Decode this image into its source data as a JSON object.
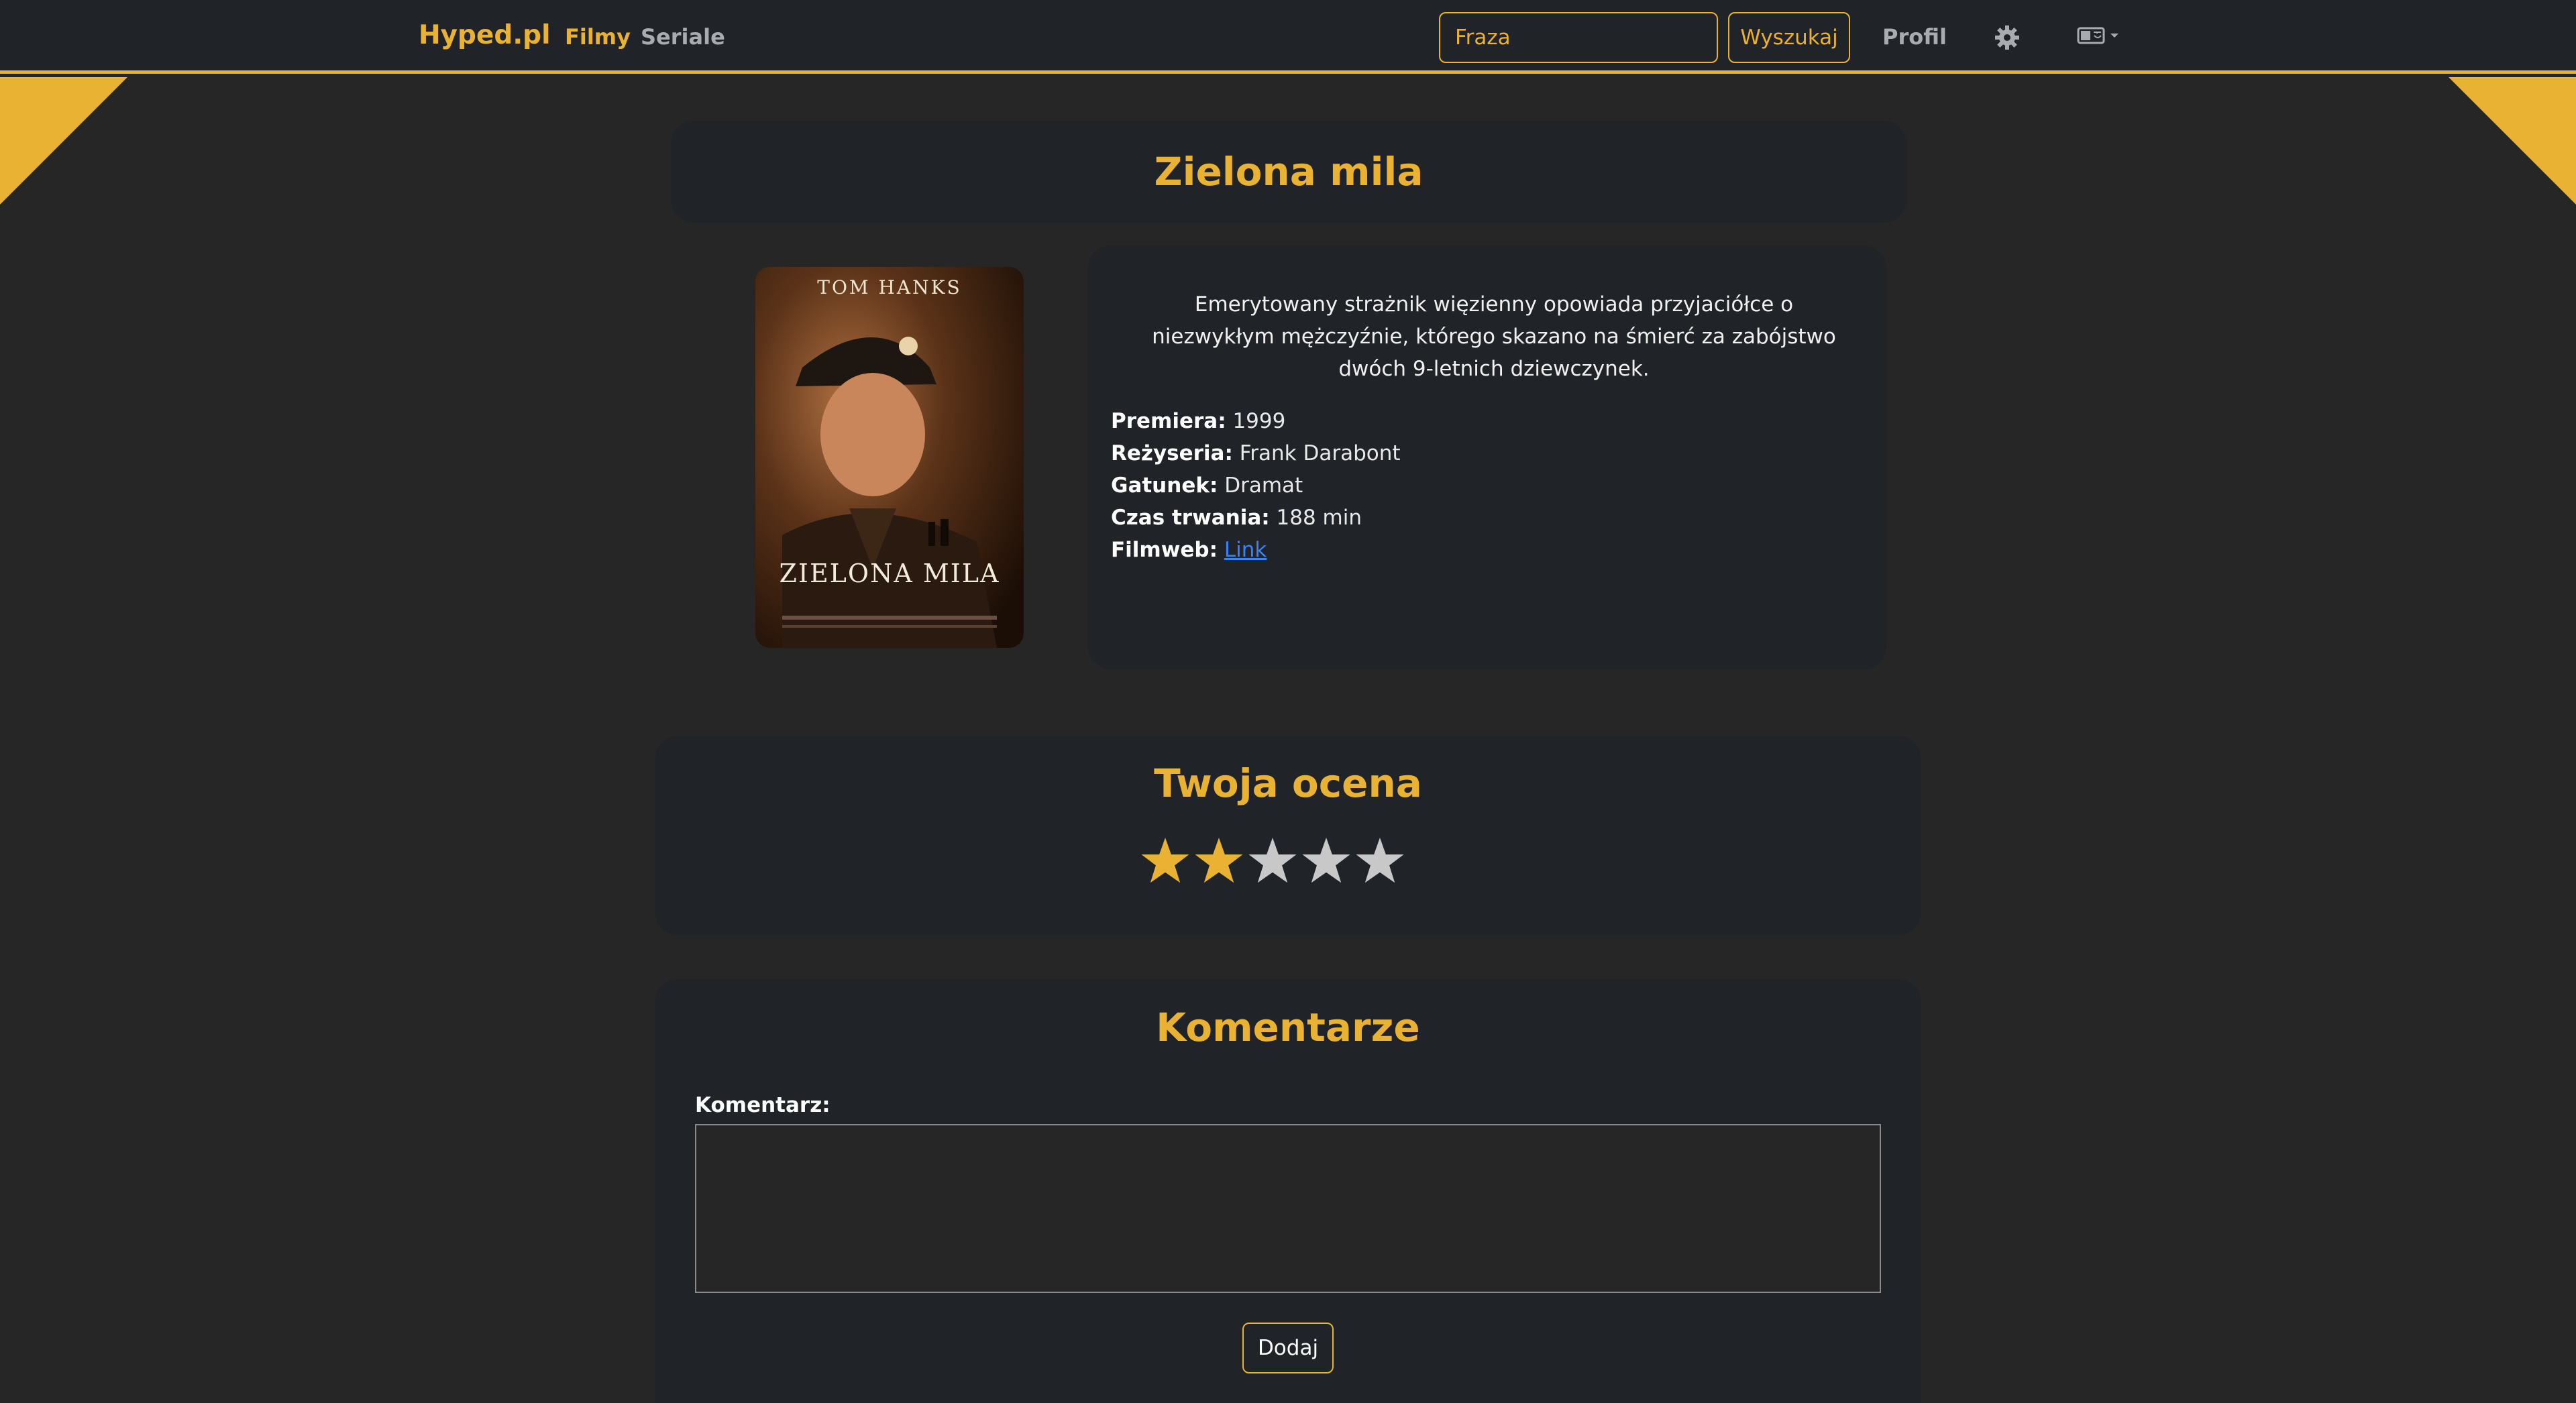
{
  "navbar": {
    "brand": "Hyped.pl",
    "links": [
      "Filmy",
      "Seriale"
    ],
    "search": {
      "placeholder": "Fraza",
      "button_label": "Wyszukaj"
    },
    "profile_label": "Profil",
    "icons": [
      "gear-icon",
      "language-icon"
    ]
  },
  "movie": {
    "title": "Zielona mila",
    "description": "Emerytowany strażnik więzienny opowiada przyjaciółce o niezwykłym mężczyźnie, którego skazano na śmierć za zabójstwo dwóch 9-letnich dziewczynek.",
    "poster": {
      "top_text": "TOM HANKS",
      "title_text": "ZIELONA MILA"
    },
    "details": {
      "premiere_label": "Premiera:",
      "premiere": "1999",
      "director_label": "Reżyseria:",
      "director": "Frank Darabont",
      "genre_label": "Gatunek:",
      "genre": "Dramat",
      "duration_label": "Czas trwania:",
      "duration": "188 min",
      "filmweb_label": "Filmweb:",
      "filmweb_link": "Link"
    }
  },
  "rating": {
    "heading": "Twoja ocena",
    "value": 2,
    "max": 5
  },
  "comments": {
    "heading": "Komentarze",
    "label": "Komentarz:",
    "textarea_value": "",
    "submit_label": "Dodaj"
  },
  "colors": {
    "accent": "#e9b233",
    "card": "#202327",
    "background": "#262626",
    "link": "#3b82f6",
    "star_empty": "#c8c8c8"
  }
}
